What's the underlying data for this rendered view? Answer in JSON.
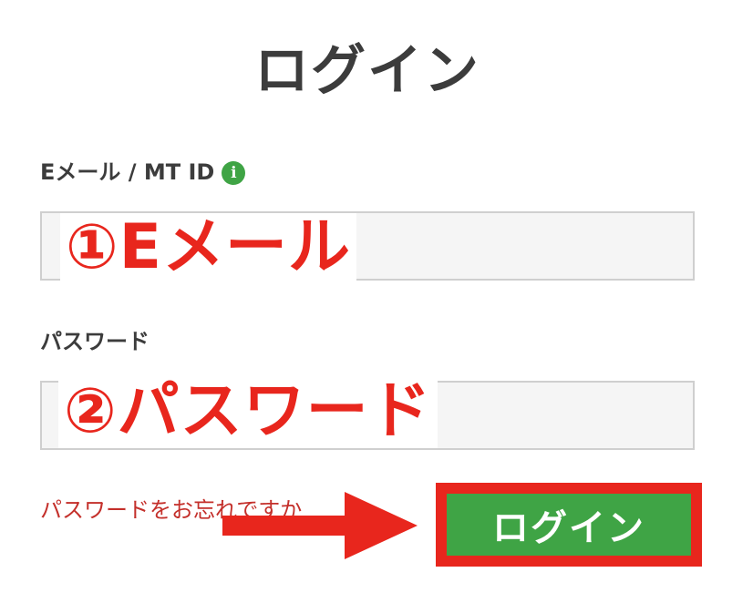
{
  "page": {
    "title": "ログイン"
  },
  "form": {
    "email_label": "Eメール / MT ID",
    "info_icon_glyph": "i",
    "email_value": "",
    "email_annotation": "①Eメール",
    "password_label": "パスワード",
    "password_value": "",
    "password_annotation": "②パスワード",
    "forgot_link": "パスワードをお忘れですか",
    "login_button": "ログイン"
  },
  "icons": {
    "info": "info-icon",
    "arrow": "arrow-right-icon"
  },
  "colors": {
    "accent_green": "#3fa445",
    "annotation_red": "#e8261d",
    "link_red": "#c4302b",
    "text_dark": "#3c3c3c",
    "field_bg": "#f5f5f5"
  }
}
